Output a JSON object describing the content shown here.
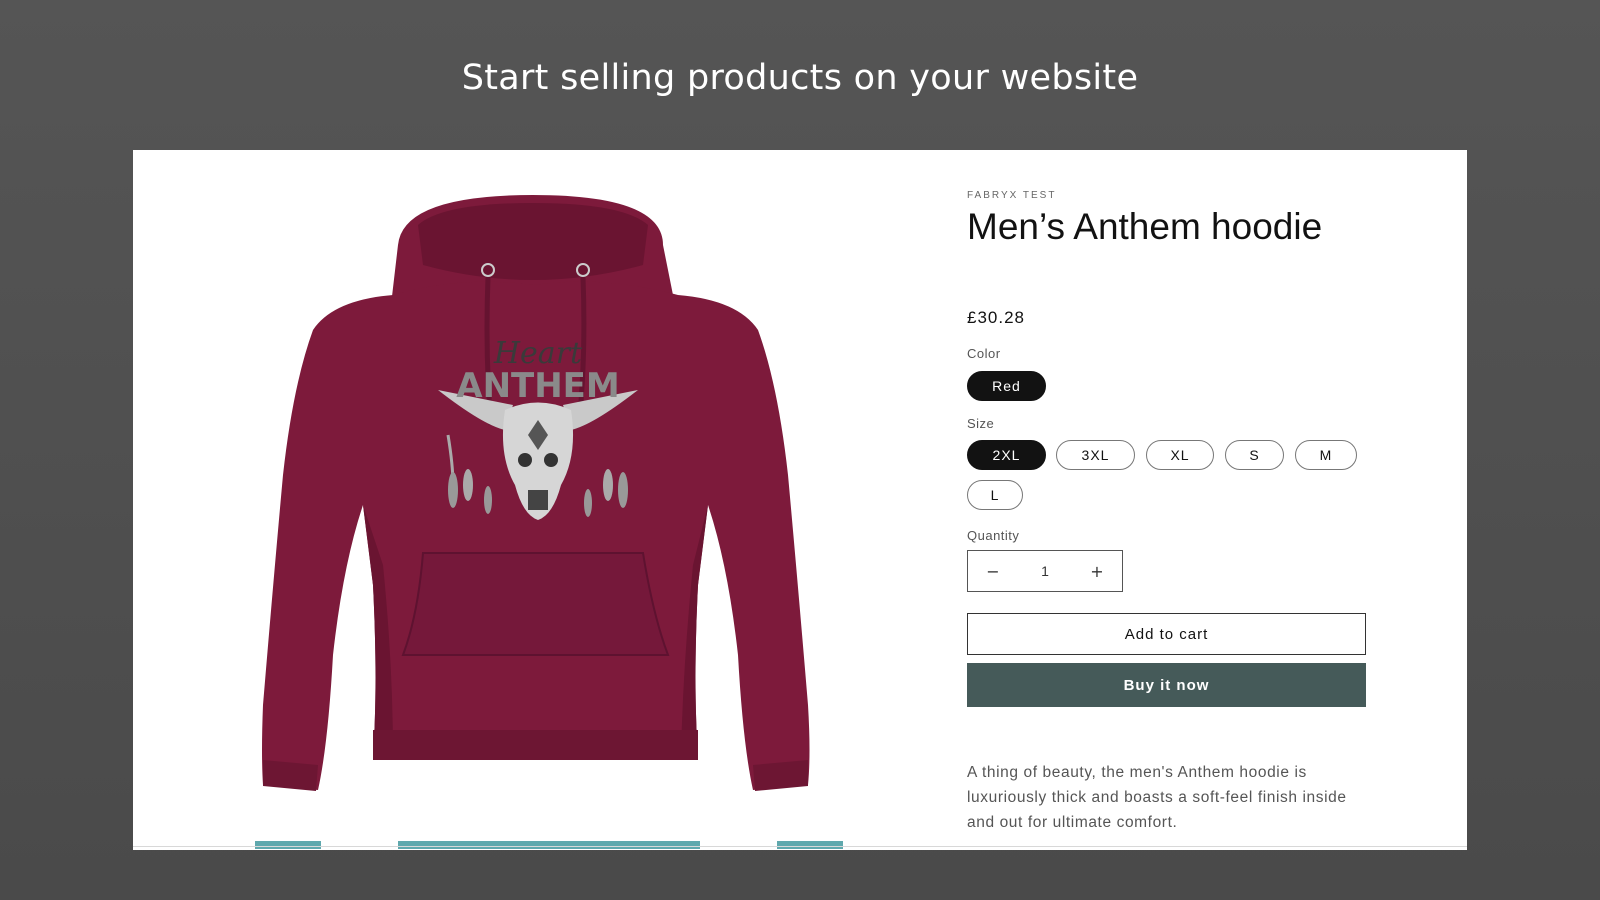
{
  "headline": "Start selling products on your website",
  "product": {
    "vendor": "FABRYX TEST",
    "title": "Men’s Anthem hoodie",
    "price": "£30.28",
    "image_text_top": "Heart",
    "image_text_main": "ANTHEM",
    "color_label": "Color",
    "colors": [
      "Red"
    ],
    "selected_color": "Red",
    "size_label": "Size",
    "sizes": [
      "2XL",
      "3XL",
      "XL",
      "S",
      "M",
      "L"
    ],
    "selected_size": "2XL",
    "quantity_label": "Quantity",
    "quantity": "1",
    "add_to_cart_label": "Add to cart",
    "buy_now_label": "Buy it now",
    "description": "A thing of beauty, the men's Anthem hoodie is luxuriously thick and boasts a soft-feel finish inside and out for ultimate comfort."
  },
  "colors": {
    "page_bg": "#555555",
    "hoodie": "#7d1a3b",
    "buy_button": "#455a59",
    "selected_pill": "#121212",
    "thumb_accent": "#5fa8ad"
  }
}
